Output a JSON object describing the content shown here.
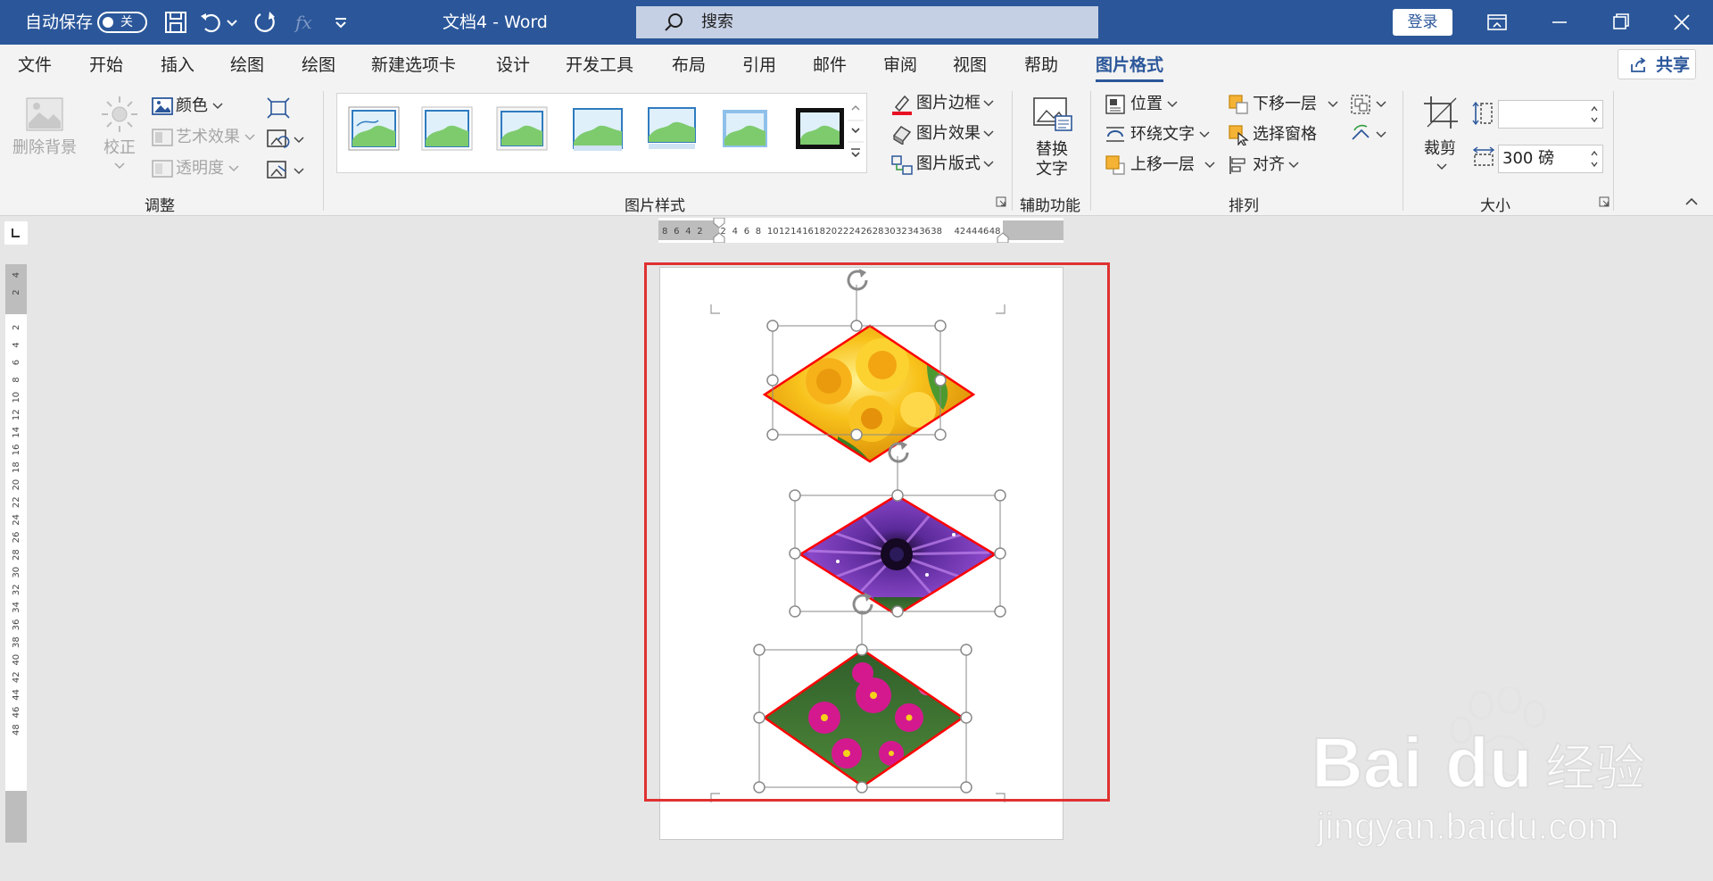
{
  "titlebar": {
    "autosave_label": "自动保存",
    "autosave_state": "关",
    "doc_title": "文档4  -  Word",
    "search_placeholder": "搜索",
    "login_label": "登录"
  },
  "tabs": [
    "文件",
    "开始",
    "插入",
    "绘图",
    "绘图",
    "新建选项卡",
    "设计",
    "开发工具",
    "布局",
    "引用",
    "邮件",
    "审阅",
    "视图",
    "帮助",
    "图片格式"
  ],
  "active_tab": "图片格式",
  "share_label": "共享",
  "ribbon": {
    "adjust": {
      "remove_bg": "删除背景",
      "correct": "校正",
      "color": "颜色",
      "art_effects": "艺术效果",
      "transparency": "透明度",
      "group_label": "调整"
    },
    "styles": {
      "border": "图片边框",
      "effects": "图片效果",
      "layout": "图片版式",
      "group_label": "图片样式"
    },
    "accessibility": {
      "alt_text_1": "替换",
      "alt_text_2": "文字",
      "group_label": "辅助功能"
    },
    "arrange": {
      "position": "位置",
      "wrap_text": "环绕文字",
      "bring_forward": "上移一层",
      "send_backward": "下移一层",
      "selection_pane": "选择窗格",
      "align": "对齐",
      "group_label": "排列"
    },
    "size": {
      "crop": "裁剪",
      "height_value": "",
      "width_value": "300 磅",
      "group_label": "大小"
    }
  },
  "hruler_ticks": [
    "8",
    "6",
    "4",
    "2",
    "",
    "2",
    "4",
    "6",
    "8",
    "10",
    "12",
    "14",
    "16",
    "18",
    "20",
    "22",
    "24",
    "26",
    "28",
    "30",
    "32",
    "34",
    "36",
    "38",
    "",
    "42",
    "44",
    "46",
    "48"
  ],
  "vruler_ticks": [
    "4",
    "2",
    "",
    "2",
    "4",
    "6",
    "8",
    "10",
    "12",
    "14",
    "16",
    "18",
    "20",
    "22",
    "24",
    "26",
    "28",
    "30",
    "32",
    "34",
    "36",
    "38",
    "40",
    "42",
    "44",
    "46",
    "48"
  ],
  "watermark": {
    "brand": "Bai",
    "brand2": "du",
    "suffix": "经验",
    "url": "jingyan.baidu.com"
  },
  "colors": {
    "titlebar": "#2b579a",
    "accent_red": "#e03131"
  }
}
